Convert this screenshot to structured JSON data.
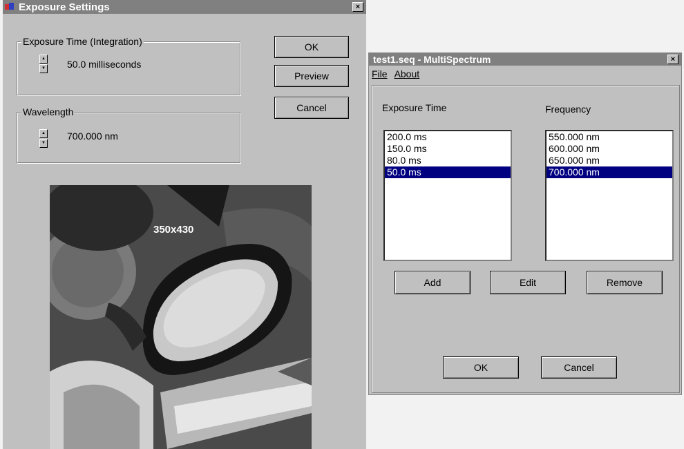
{
  "exposure_window": {
    "title": "Exposure Settings",
    "close_label": "×",
    "exposure_group_label": "Exposure Time (Integration)",
    "exposure_value": "50.0 milliseconds",
    "wavelength_group_label": "Wavelength",
    "wavelength_value": "700.000 nm",
    "buttons": {
      "ok": "OK",
      "preview": "Preview",
      "cancel": "Cancel"
    },
    "image_size_overlay": "350x430"
  },
  "multispectrum_window": {
    "title": "test1.seq - MultiSpectrum",
    "close_label": "×",
    "menu": {
      "file": "File",
      "about": "About"
    },
    "exposure_header": "Exposure Time",
    "frequency_header": "Frequency",
    "exposure_list": [
      "200.0 ms",
      "150.0 ms",
      "80.0 ms",
      "50.0 ms"
    ],
    "frequency_list": [
      "550.000 nm",
      "600.000 nm",
      "650.000 nm",
      "700.000 nm"
    ],
    "selected_index": 3,
    "buttons": {
      "add": "Add",
      "edit": "Edit",
      "remove": "Remove",
      "ok": "OK",
      "cancel": "Cancel"
    }
  },
  "colors": {
    "window_bg": "#c0c0c0",
    "title_bg": "#808080",
    "selection_bg": "#000080"
  },
  "icons": {
    "spinner_up": "▲",
    "spinner_down": "▼"
  }
}
